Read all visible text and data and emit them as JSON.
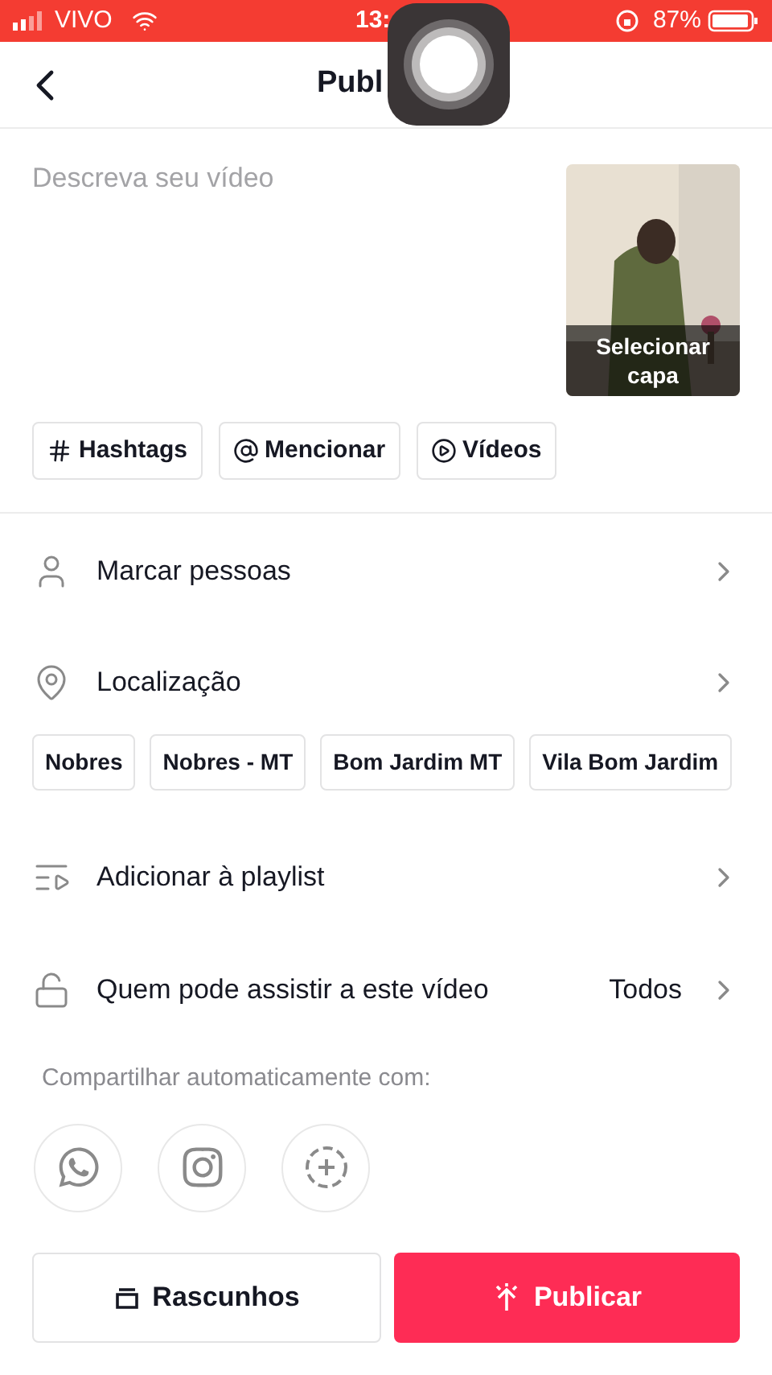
{
  "status_bar": {
    "carrier": "VIVO",
    "time": "13:",
    "battery": "87%"
  },
  "header": {
    "title": "Publ"
  },
  "description": {
    "placeholder": "Descreva seu vídeo"
  },
  "cover": {
    "label": "Selecionar capa"
  },
  "tags": [
    {
      "kind": "hashtag",
      "label": "Hashtags"
    },
    {
      "kind": "mention",
      "label": "Mencionar"
    },
    {
      "kind": "video",
      "label": "Vídeos"
    }
  ],
  "tag_people": {
    "label": "Marcar pessoas"
  },
  "location": {
    "label": "Localização",
    "suggestions": [
      "Nobres",
      "Nobres - MT",
      "Bom Jardim MT",
      "Vila Bom Jardim"
    ]
  },
  "playlist": {
    "label": "Adicionar à playlist"
  },
  "privacy": {
    "label": "Quem pode assistir a este vídeo",
    "value": "Todos"
  },
  "share": {
    "label": "Compartilhar automaticamente com:",
    "targets": [
      {
        "kind": "chat"
      },
      {
        "kind": "camera"
      },
      {
        "kind": "add"
      }
    ]
  },
  "actions": [
    {
      "kind": "drafts",
      "label": "Rascunhos"
    },
    {
      "kind": "publish",
      "label": "Publicar"
    }
  ]
}
